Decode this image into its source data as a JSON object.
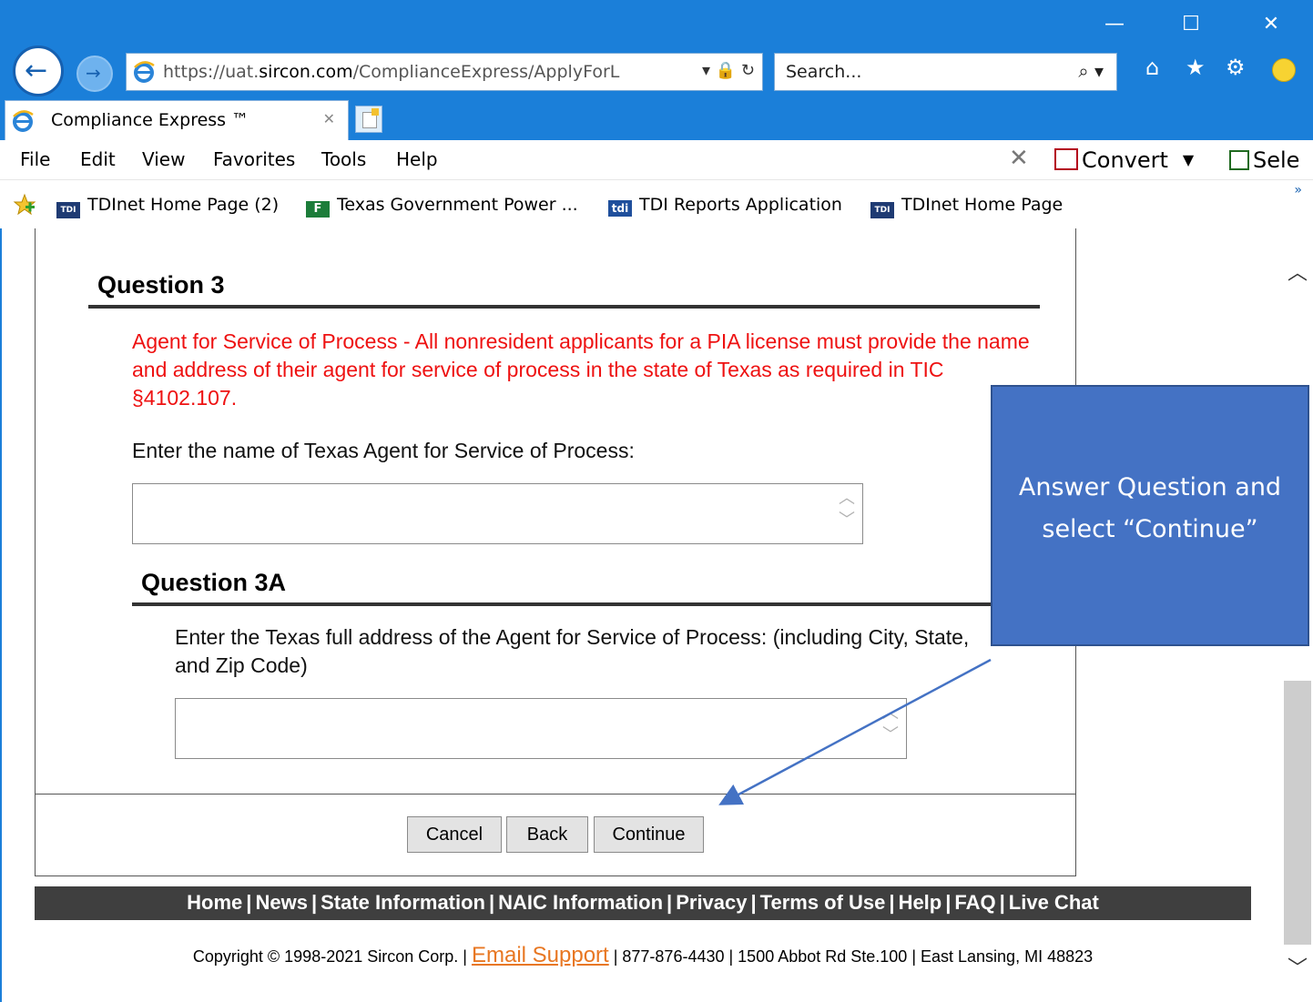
{
  "window": {
    "minimize_glyph": "—",
    "maximize_glyph": "☐",
    "close_glyph": "✕"
  },
  "address_bar": {
    "url_prefix": "https://uat.",
    "url_domain": "sircon.com",
    "url_path": "/ComplianceExpress/ApplyForL",
    "tools": "▾ 🔒 ↻"
  },
  "search": {
    "placeholder": "Search...",
    "icon": "search-icon",
    "tools": "⌕ ▾"
  },
  "tab": {
    "title": "Compliance Express ™",
    "close_glyph": "✕"
  },
  "menu": {
    "items": [
      "File",
      "Edit",
      "View",
      "Favorites",
      "Tools",
      "Help"
    ],
    "close_glyph": "✕",
    "convert_label": "Convert",
    "select_label": "Sele"
  },
  "favorites": {
    "items": [
      {
        "label": "TDInet Home Page (2)",
        "icon": "TDI"
      },
      {
        "label": "Texas Government Power ...",
        "icon": "F"
      },
      {
        "label": "TDI Reports Application",
        "icon": "tdi"
      },
      {
        "label": "TDInet Home Page",
        "icon": "TDI"
      }
    ],
    "more_glyph": "»"
  },
  "form": {
    "question3": {
      "title": "Question 3",
      "notice": "Agent for Service of Process - All nonresident applicants for a PIA license must provide the name and address of their agent for service of process in the state of Texas as required in TIC §4102.107.",
      "prompt": "Enter the name of Texas Agent for Service of Process:",
      "value": ""
    },
    "question3a": {
      "title": "Question 3A",
      "prompt": "Enter the Texas full address of the Agent for Service of Process: (including City, State, and Zip Code)",
      "value": ""
    },
    "buttons": {
      "cancel": "Cancel",
      "back": "Back",
      "continue": "Continue"
    }
  },
  "footer": {
    "links": [
      "Home",
      "News",
      "State Information",
      "NAIC Information",
      "Privacy",
      "Terms of Use",
      "Help",
      "FAQ",
      "Live Chat"
    ],
    "copyright_before": "Copyright © 1998-2021 Sircon Corp. | ",
    "email_label": "Email Support",
    "copyright_after": " | 877-876-4430 | 1500 Abbot Rd Ste.100 | East Lansing, MI 48823"
  },
  "callout": {
    "text": "Answer Question and select “Continue”"
  },
  "colors": {
    "chrome_blue": "#1b7fd9",
    "notice_red": "#ee1111",
    "footer_dark": "#3f3f3f",
    "email_orange": "#e87722",
    "callout_blue": "#4472c4"
  }
}
